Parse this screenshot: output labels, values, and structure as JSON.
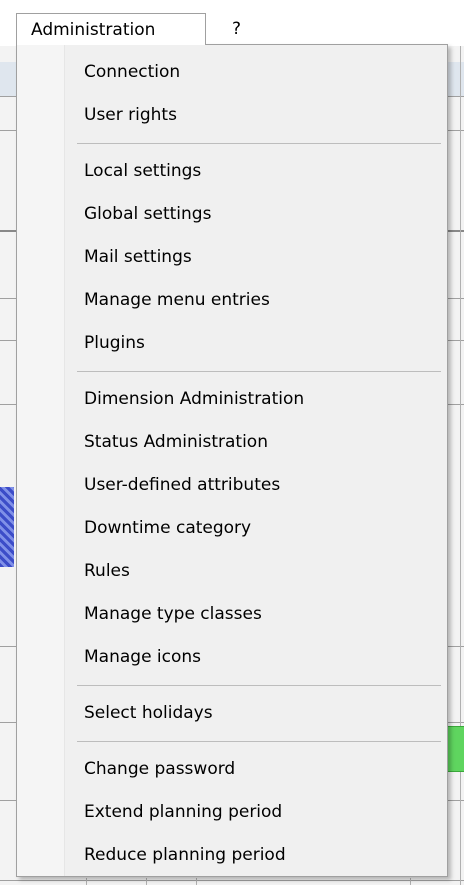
{
  "menubar": {
    "administration_label": "Administration",
    "help_label": "?"
  },
  "menu": {
    "groups": [
      [
        {
          "label": "Connection"
        },
        {
          "label": "User rights"
        }
      ],
      [
        {
          "label": "Local settings"
        },
        {
          "label": "Global settings"
        },
        {
          "label": "Mail settings"
        },
        {
          "label": "Manage menu entries"
        },
        {
          "label": "Plugins"
        }
      ],
      [
        {
          "label": "Dimension Administration"
        },
        {
          "label": "Status Administration"
        },
        {
          "label": "User-defined attributes"
        },
        {
          "label": "Downtime category"
        },
        {
          "label": "Rules"
        },
        {
          "label": "Manage type classes"
        },
        {
          "label": "Manage icons"
        }
      ],
      [
        {
          "label": "Select holidays"
        }
      ],
      [
        {
          "label": "Change password"
        },
        {
          "label": "Extend planning period"
        },
        {
          "label": "Reduce planning period"
        }
      ]
    ]
  }
}
